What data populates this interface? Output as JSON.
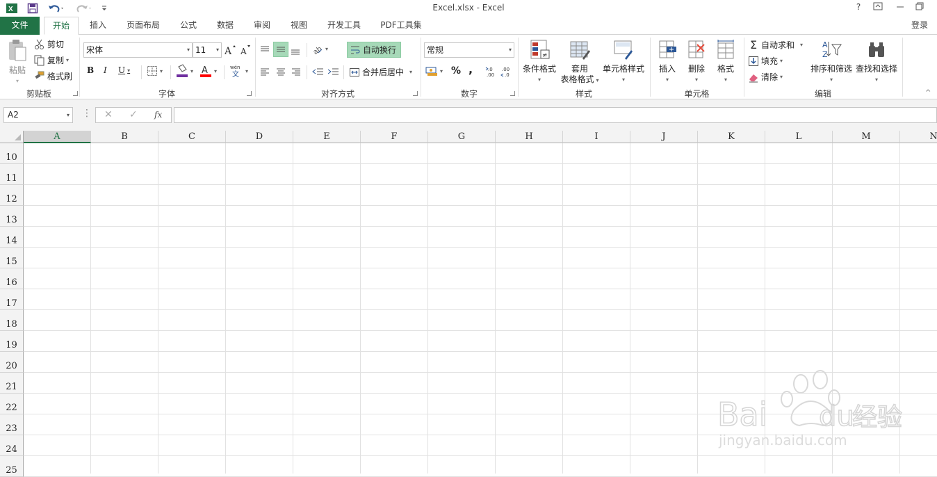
{
  "window": {
    "title": "Excel.xlsx - Excel",
    "help": "?",
    "controls": [
      "⊡",
      "—",
      "🗗"
    ]
  },
  "quick_access": {
    "app_icon": "excel-logo-icon",
    "save_icon": "save-icon",
    "undo_icon": "undo-icon",
    "redo_icon": "redo-icon",
    "customize_icon": "customize-icon"
  },
  "tabs": {
    "file": "文件",
    "items": [
      "开始",
      "插入",
      "页面布局",
      "公式",
      "数据",
      "审阅",
      "视图",
      "开发工具",
      "PDF工具集"
    ],
    "active": "开始",
    "login": "登录"
  },
  "ribbon": {
    "clipboard": {
      "label": "剪贴板",
      "paste": "粘贴",
      "cut": "剪切",
      "copy": "复制",
      "format_painter": "格式刷"
    },
    "font": {
      "label": "字体",
      "font_name": "宋体",
      "font_size": "11",
      "bold": "B",
      "italic": "I",
      "underline": "U",
      "phonetic": "wén",
      "font_color_label": "A"
    },
    "alignment": {
      "label": "对齐方式",
      "wrap_text": "自动换行",
      "merge_center": "合并后居中"
    },
    "number": {
      "label": "数字",
      "format": "常规",
      "percent": "%",
      "comma": ","
    },
    "styles": {
      "label": "样式",
      "conditional": "条件格式",
      "table_format_1": "套用",
      "table_format_2": "表格格式",
      "cell_styles": "单元格样式"
    },
    "cells": {
      "label": "单元格",
      "insert": "插入",
      "delete": "删除",
      "format": "格式"
    },
    "editing": {
      "label": "编辑",
      "autosum": "自动求和",
      "fill": "填充",
      "clear": "清除",
      "sort_filter": "排序和筛选",
      "find_select": "查找和选择"
    }
  },
  "formula_bar": {
    "name_box": "A2",
    "fx": "fx",
    "formula": ""
  },
  "grid": {
    "columns": [
      "A",
      "B",
      "C",
      "D",
      "E",
      "F",
      "G",
      "H",
      "I",
      "J",
      "K",
      "L",
      "M",
      "N"
    ],
    "rows": [
      "10",
      "11",
      "12",
      "13",
      "14",
      "15",
      "16",
      "17",
      "18",
      "19",
      "20",
      "21",
      "22",
      "23",
      "24",
      "25"
    ],
    "selected_column": "A"
  },
  "watermark": {
    "brand": "Bai",
    "brand2": "du",
    "brand_cn": "经验",
    "url": "jingyan.baidu.com"
  },
  "colors": {
    "excel_green": "#217346",
    "wrap_active_bg": "#a6d9b8"
  }
}
